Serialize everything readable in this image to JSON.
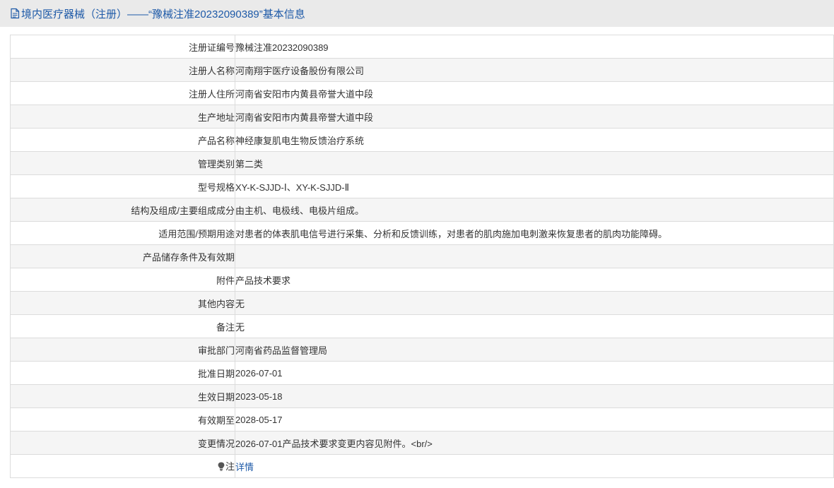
{
  "page": {
    "title": "境内医疗器械（注册）——“豫械注准20232090389”基本信息",
    "title_icon": "document-icon",
    "accent_color": "#1e5aa8"
  },
  "rows": [
    {
      "label": "注册证编号",
      "value": "豫械注准20232090389"
    },
    {
      "label": "注册人名称",
      "value": "河南翔宇医疗设备股份有限公司"
    },
    {
      "label": "注册人住所",
      "value": "河南省安阳市内黄县帝誉大道中段"
    },
    {
      "label": "生产地址",
      "value": "河南省安阳市内黄县帝誉大道中段"
    },
    {
      "label": "产品名称",
      "value": "神经康复肌电生物反馈治疗系统"
    },
    {
      "label": "管理类别",
      "value": "第二类"
    },
    {
      "label": "型号规格",
      "value": "XY-K-SJJD-Ⅰ、XY-K-SJJD-Ⅱ"
    },
    {
      "label": "结构及组成/主要组成成分",
      "value": "由主机、电极线、电极片组成。"
    },
    {
      "label": "适用范围/预期用途",
      "value": "对患者的体表肌电信号进行采集、分析和反馈训练，对患者的肌肉施加电刺激来恢复患者的肌肉功能障碍。"
    },
    {
      "label": "产品储存条件及有效期",
      "value": ""
    },
    {
      "label": "附件",
      "value": "产品技术要求"
    },
    {
      "label": "其他内容",
      "value": "无"
    },
    {
      "label": "备注",
      "value": "无"
    },
    {
      "label": "审批部门",
      "value": "河南省药品监督管理局"
    },
    {
      "label": "批准日期",
      "value": "2026-07-01"
    },
    {
      "label": "生效日期",
      "value": "2023-05-18"
    },
    {
      "label": "有效期至",
      "value": "2028-05-17"
    },
    {
      "label": "变更情况",
      "value": "2026-07-01产品技术要求变更内容见附件。<br/>"
    }
  ],
  "note_row": {
    "icon": "lightbulb-icon",
    "label": "注",
    "link_text": "详情"
  }
}
